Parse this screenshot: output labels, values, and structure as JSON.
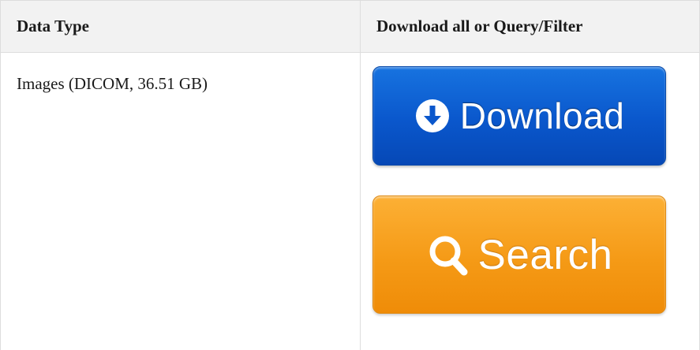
{
  "table": {
    "headers": [
      "Data Type",
      "Download all or Query/Filter"
    ],
    "rows": [
      {
        "data_type": "Images (DICOM, 36.51 GB)"
      }
    ]
  },
  "buttons": {
    "download": {
      "label": "Download",
      "icon": "circle-arrow-down-icon",
      "color": "#0a57cc"
    },
    "search": {
      "label": "Search",
      "icon": "magnifier-icon",
      "color": "#f59a16"
    }
  }
}
